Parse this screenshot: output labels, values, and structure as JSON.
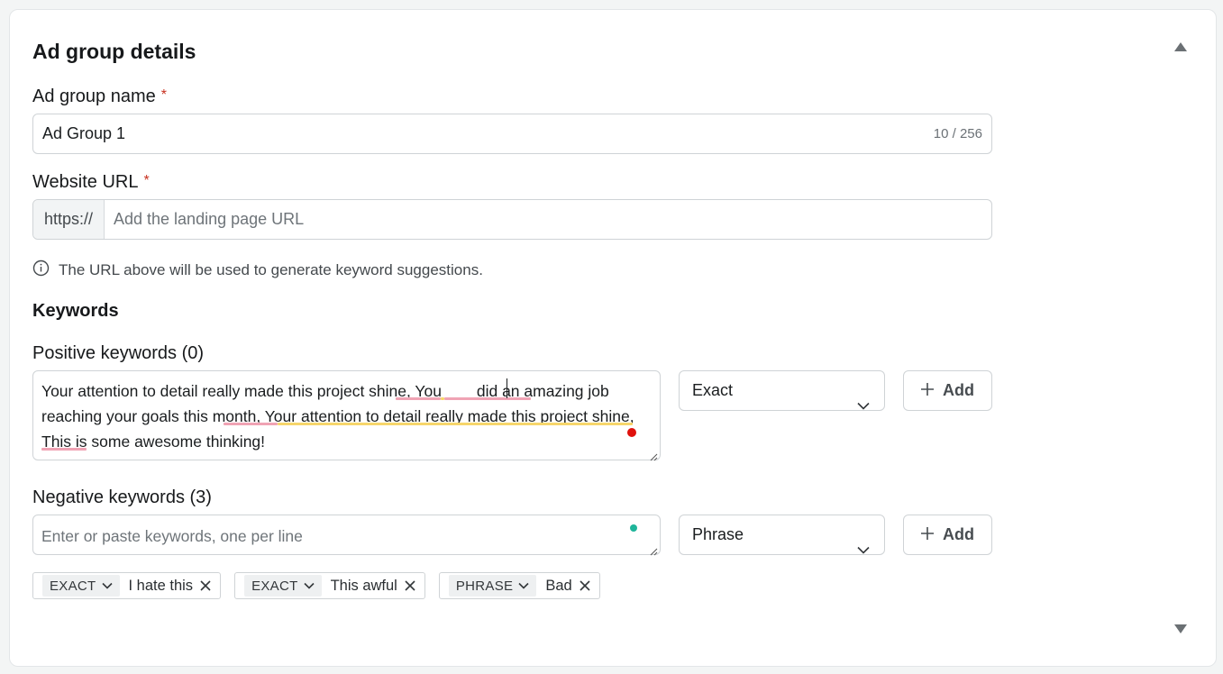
{
  "card": {
    "title": "Ad group details"
  },
  "ad_group_name": {
    "label": "Ad group name",
    "required_mark": "*",
    "value": "Ad Group 1",
    "counter": "10 / 256"
  },
  "website_url": {
    "label": "Website URL",
    "required_mark": "*",
    "prefix": "https://",
    "placeholder": "Add the landing page URL",
    "info": "The URL above will be used to generate keyword suggestions."
  },
  "keywords": {
    "title": "Keywords",
    "positive": {
      "label": "Positive keywords (0)",
      "text": "Your attention to detail really made this project shine, You        did an amazing job reaching your goals this month, Your attention to detail really made this project shine, This is some awesome thinking!",
      "match_type": "Exact",
      "add_label": "Add"
    },
    "negative": {
      "label": "Negative keywords (3)",
      "placeholder": "Enter or paste keywords, one per line",
      "match_type": "Phrase",
      "add_label": "Add",
      "chips": [
        {
          "type": "EXACT",
          "text": "I hate this"
        },
        {
          "type": "EXACT",
          "text": "This awful"
        },
        {
          "type": "PHRASE",
          "text": "Bad"
        }
      ]
    }
  },
  "icons": {
    "collapse": "triangle-up-icon",
    "scroll": "triangle-down-icon",
    "info": "info-circle-icon",
    "chevron": "chevron-down-icon",
    "plus": "plus-icon",
    "remove": "close-icon"
  },
  "colors": {
    "required": "#c7301f",
    "spell_error": "#f0a3b4",
    "grammar": "#f7d66b",
    "status_red": "#e0110c",
    "status_teal": "#1fb59a"
  }
}
